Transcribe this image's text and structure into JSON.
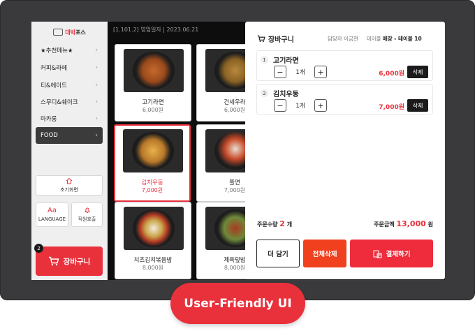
{
  "brand": {
    "small_text": "대박식당",
    "name_prefix": "대박",
    "name_suffix": "포스"
  },
  "header": {
    "info": "[1.101.2]  영업일자 | 2023.06.21"
  },
  "sidebar": {
    "items": [
      {
        "label": "★추천메뉴★"
      },
      {
        "label": "커피&라떼"
      },
      {
        "label": "티&에이드"
      },
      {
        "label": "스무디&쉐이크"
      },
      {
        "label": "마카롱"
      },
      {
        "label": "FOOD"
      }
    ],
    "home_label": "초기화면",
    "language_icon_text": "Aa",
    "language_label": "LANGUAGE",
    "staff_call_label": "직원호출",
    "cart_label": "장바구니",
    "cart_badge": "2"
  },
  "menu": [
    {
      "name": "고기라면",
      "price": "6,000원"
    },
    {
      "name": "건세우라",
      "price": "6,000원"
    },
    {
      "name": "김치우동",
      "price": "7,000원"
    },
    {
      "name": "쫄면",
      "price": "7,000원"
    },
    {
      "name": "치즈김치볶음밥",
      "price": "8,000원"
    },
    {
      "name": "제육덮밥",
      "price": "8,000원"
    }
  ],
  "cart": {
    "title": "장바구니",
    "staff_label": "담당자",
    "staff_name": "이금현",
    "table_label": "테이블",
    "table_value": "매장 - 테이블 10",
    "items": [
      {
        "index": "1",
        "name": "고기라면",
        "qty": "1개",
        "price": "6,000원",
        "delete_label": "삭제"
      },
      {
        "index": "2",
        "name": "김치우동",
        "qty": "1개",
        "price": "7,000원",
        "delete_label": "삭제"
      }
    ],
    "order_qty_label": "주문수량",
    "order_qty_value": "2",
    "order_qty_unit": "개",
    "order_total_label": "주문금액",
    "order_total_value": "13,000",
    "order_total_unit": "원",
    "add_more_label": "더 담기",
    "clear_all_label": "전체삭제",
    "pay_label": "결제하기"
  },
  "caption": "User-Friendly UI",
  "colors": {
    "accent": "#e9313c",
    "clear": "#f0401e",
    "dark": "#1a1a1a"
  }
}
